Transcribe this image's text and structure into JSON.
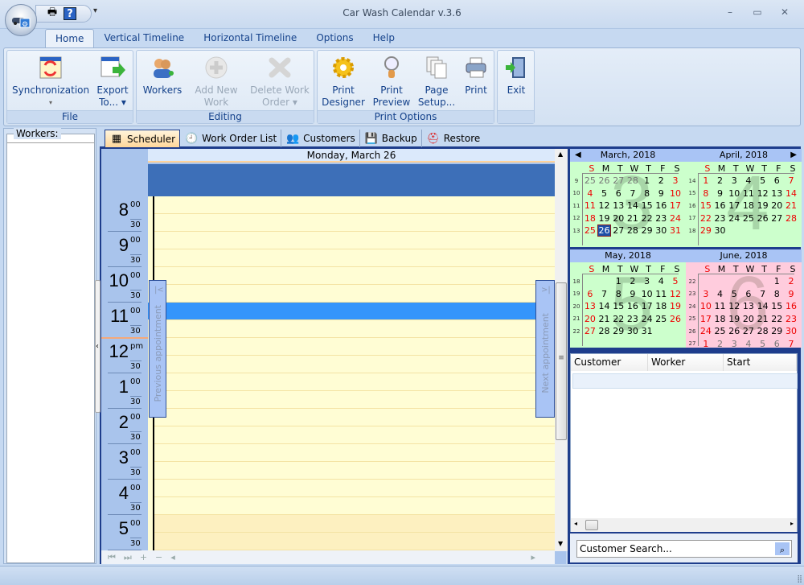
{
  "window": {
    "title": "Car Wash Calendar v.3.6",
    "controls": {
      "minimize": "–",
      "maximize": "▭",
      "close": "✕"
    }
  },
  "quick_access": {
    "print_icon": "🖶",
    "help_icon": "?",
    "customize": "▾"
  },
  "ribbon_tabs": [
    {
      "label": "Home",
      "active": true
    },
    {
      "label": "Vertical Timeline"
    },
    {
      "label": "Horizontal Timeline"
    },
    {
      "label": "Options"
    },
    {
      "label": "Help"
    }
  ],
  "ribbon": {
    "groups": {
      "file": "File",
      "editing": "Editing",
      "print_options": "Print Options"
    },
    "buttons": {
      "synchronization": {
        "line1": "Synchronization",
        "line2": "▾"
      },
      "export": {
        "line1": "Export",
        "line2": "To... ▾"
      },
      "workers": {
        "line1": "Workers",
        "line2": ""
      },
      "add_work_order": {
        "line1": "Add New",
        "line2": "Work Order",
        "disabled": true
      },
      "delete_work_order": {
        "line1": "Delete Work",
        "line2": "Order ▾",
        "disabled": true
      },
      "print_designer": {
        "line1": "Print",
        "line2": "Designer"
      },
      "print_preview": {
        "line1": "Print",
        "line2": "Preview"
      },
      "page_setup": {
        "line1": "Page",
        "line2": "Setup..."
      },
      "print": {
        "line1": "Print",
        "line2": ""
      },
      "exit": {
        "line1": "Exit",
        "line2": ""
      }
    }
  },
  "left_panel": {
    "workers_label": "Workers:"
  },
  "content_tabs": [
    {
      "label": "Scheduler",
      "active": true
    },
    {
      "label": "Work Order List"
    },
    {
      "label": "Customers"
    },
    {
      "label": "Backup"
    },
    {
      "label": "Restore"
    }
  ],
  "scheduler": {
    "day_header": "Monday, March 26",
    "hours": [
      {
        "h": "8",
        "m": "00"
      },
      {
        "h": "9",
        "m": "00"
      },
      {
        "h": "10",
        "m": "00"
      },
      {
        "h": "11",
        "m": "00"
      },
      {
        "h": "12",
        "m": "pm"
      },
      {
        "h": "1",
        "m": "00"
      },
      {
        "h": "2",
        "m": "00"
      },
      {
        "h": "3",
        "m": "00"
      },
      {
        "h": "4",
        "m": "00"
      },
      {
        "h": "5",
        "m": "00"
      }
    ],
    "half_label": "30",
    "prev_appointment": "Previous appointment",
    "next_appointment": "Next appointment",
    "prev_arrow": "|<",
    "next_arrow": ">|",
    "nav": {
      "first": "⏮",
      "last": "⏭",
      "add": "+",
      "remove": "−",
      "left": "◂",
      "right": "▸"
    }
  },
  "calendars": [
    {
      "title": "March, 2018",
      "big": "3",
      "nav": "left",
      "weeks": [
        {
          "n": "9",
          "days": [
            [
              "25",
              "g"
            ],
            [
              "26",
              "g"
            ],
            [
              "27",
              "g"
            ],
            [
              "28",
              "g"
            ],
            [
              "1",
              ""
            ],
            [
              "2",
              ""
            ],
            [
              "3",
              "r"
            ]
          ]
        },
        {
          "n": "10",
          "days": [
            [
              "4",
              "r"
            ],
            [
              "5",
              ""
            ],
            [
              "6",
              ""
            ],
            [
              "7",
              ""
            ],
            [
              "8",
              ""
            ],
            [
              "9",
              ""
            ],
            [
              "10",
              "r"
            ]
          ]
        },
        {
          "n": "11",
          "days": [
            [
              "11",
              "r"
            ],
            [
              "12",
              ""
            ],
            [
              "13",
              ""
            ],
            [
              "14",
              ""
            ],
            [
              "15",
              ""
            ],
            [
              "16",
              ""
            ],
            [
              "17",
              "r"
            ]
          ]
        },
        {
          "n": "12",
          "days": [
            [
              "18",
              "r"
            ],
            [
              "19",
              ""
            ],
            [
              "20",
              ""
            ],
            [
              "21",
              ""
            ],
            [
              "22",
              ""
            ],
            [
              "23",
              ""
            ],
            [
              "24",
              "r"
            ]
          ]
        },
        {
          "n": "13",
          "days": [
            [
              "25",
              "r"
            ],
            [
              "26",
              "t"
            ],
            [
              "27",
              ""
            ],
            [
              "28",
              ""
            ],
            [
              "29",
              ""
            ],
            [
              "30",
              ""
            ],
            [
              "31",
              "r"
            ]
          ]
        }
      ]
    },
    {
      "title": "April, 2018",
      "big": "4",
      "nav": "right",
      "weeks": [
        {
          "n": "14",
          "days": [
            [
              "1",
              "r"
            ],
            [
              "2",
              ""
            ],
            [
              "3",
              ""
            ],
            [
              "4",
              ""
            ],
            [
              "5",
              ""
            ],
            [
              "6",
              ""
            ],
            [
              "7",
              "r"
            ]
          ]
        },
        {
          "n": "15",
          "days": [
            [
              "8",
              "r"
            ],
            [
              "9",
              ""
            ],
            [
              "10",
              ""
            ],
            [
              "11",
              ""
            ],
            [
              "12",
              ""
            ],
            [
              "13",
              ""
            ],
            [
              "14",
              "r"
            ]
          ]
        },
        {
          "n": "16",
          "days": [
            [
              "15",
              "r"
            ],
            [
              "16",
              ""
            ],
            [
              "17",
              ""
            ],
            [
              "18",
              ""
            ],
            [
              "19",
              ""
            ],
            [
              "20",
              ""
            ],
            [
              "21",
              "r"
            ]
          ]
        },
        {
          "n": "17",
          "days": [
            [
              "22",
              "r"
            ],
            [
              "23",
              ""
            ],
            [
              "24",
              ""
            ],
            [
              "25",
              ""
            ],
            [
              "26",
              ""
            ],
            [
              "27",
              ""
            ],
            [
              "28",
              "r"
            ]
          ]
        },
        {
          "n": "18",
          "days": [
            [
              "29",
              "r"
            ],
            [
              "30",
              ""
            ],
            [
              "",
              ""
            ],
            [
              "",
              ""
            ],
            [
              "",
              ""
            ],
            [
              "",
              ""
            ],
            [
              "",
              ""
            ]
          ]
        }
      ]
    },
    {
      "title": "May, 2018",
      "big": "5",
      "nav": "",
      "weeks": [
        {
          "n": "18",
          "days": [
            [
              "",
              ""
            ],
            [
              "",
              ""
            ],
            [
              "1",
              ""
            ],
            [
              "2",
              ""
            ],
            [
              "3",
              ""
            ],
            [
              "4",
              ""
            ],
            [
              "5",
              "r"
            ]
          ]
        },
        {
          "n": "19",
          "days": [
            [
              "6",
              "r"
            ],
            [
              "7",
              ""
            ],
            [
              "8",
              ""
            ],
            [
              "9",
              ""
            ],
            [
              "10",
              ""
            ],
            [
              "11",
              ""
            ],
            [
              "12",
              "r"
            ]
          ]
        },
        {
          "n": "20",
          "days": [
            [
              "13",
              "r"
            ],
            [
              "14",
              ""
            ],
            [
              "15",
              ""
            ],
            [
              "16",
              ""
            ],
            [
              "17",
              ""
            ],
            [
              "18",
              ""
            ],
            [
              "19",
              "r"
            ]
          ]
        },
        {
          "n": "21",
          "days": [
            [
              "20",
              "r"
            ],
            [
              "21",
              ""
            ],
            [
              "22",
              ""
            ],
            [
              "23",
              ""
            ],
            [
              "24",
              ""
            ],
            [
              "25",
              ""
            ],
            [
              "26",
              "r"
            ]
          ]
        },
        {
          "n": "22",
          "days": [
            [
              "27",
              "r"
            ],
            [
              "28",
              ""
            ],
            [
              "29",
              ""
            ],
            [
              "30",
              ""
            ],
            [
              "31",
              ""
            ],
            [
              "",
              ""
            ],
            [
              "",
              ""
            ]
          ]
        }
      ]
    },
    {
      "title": "June, 2018",
      "big": "6",
      "nav": "",
      "pink": true,
      "weeks": [
        {
          "n": "22",
          "days": [
            [
              "",
              ""
            ],
            [
              "",
              ""
            ],
            [
              "",
              ""
            ],
            [
              "",
              ""
            ],
            [
              "",
              ""
            ],
            [
              "1",
              ""
            ],
            [
              "2",
              "r"
            ]
          ]
        },
        {
          "n": "23",
          "days": [
            [
              "3",
              "r"
            ],
            [
              "4",
              ""
            ],
            [
              "5",
              ""
            ],
            [
              "6",
              ""
            ],
            [
              "7",
              ""
            ],
            [
              "8",
              ""
            ],
            [
              "9",
              "r"
            ]
          ]
        },
        {
          "n": "24",
          "days": [
            [
              "10",
              "r"
            ],
            [
              "11",
              ""
            ],
            [
              "12",
              ""
            ],
            [
              "13",
              ""
            ],
            [
              "14",
              ""
            ],
            [
              "15",
              ""
            ],
            [
              "16",
              "r"
            ]
          ]
        },
        {
          "n": "25",
          "days": [
            [
              "17",
              "r"
            ],
            [
              "18",
              ""
            ],
            [
              "19",
              ""
            ],
            [
              "20",
              ""
            ],
            [
              "21",
              ""
            ],
            [
              "22",
              ""
            ],
            [
              "23",
              "r"
            ]
          ]
        },
        {
          "n": "26",
          "days": [
            [
              "24",
              "r"
            ],
            [
              "25",
              ""
            ],
            [
              "26",
              ""
            ],
            [
              "27",
              ""
            ],
            [
              "28",
              ""
            ],
            [
              "29",
              ""
            ],
            [
              "30",
              "r"
            ]
          ]
        },
        {
          "n": "27",
          "days": [
            [
              "1",
              "r"
            ],
            [
              "2",
              "g"
            ],
            [
              "3",
              "g"
            ],
            [
              "4",
              "g"
            ],
            [
              "5",
              "g"
            ],
            [
              "6",
              "g"
            ],
            [
              "7",
              "r"
            ]
          ]
        }
      ]
    }
  ],
  "weekdays": [
    "S",
    "M",
    "T",
    "W",
    "T",
    "F",
    "S"
  ],
  "appointment_list": {
    "columns": [
      "Customer",
      "Worker",
      "Start"
    ]
  },
  "search": {
    "placeholder": "Customer Search...",
    "icon": "binoculars-icon"
  }
}
